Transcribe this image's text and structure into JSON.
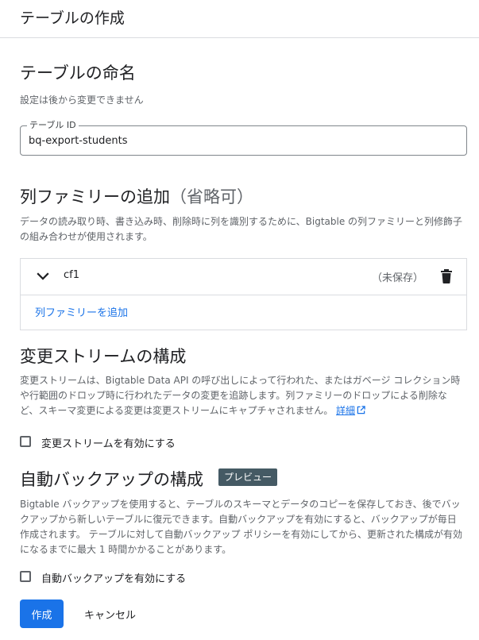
{
  "header": {
    "title": "テーブルの作成"
  },
  "naming": {
    "heading": "テーブルの命名",
    "note": "設定は後から変更できません",
    "table_id_label": "テーブル ID",
    "table_id_value": "bq-export-students"
  },
  "column_families": {
    "heading": "列ファミリーの追加",
    "heading_suffix": "（省略可）",
    "description": "データの読み取り時、書き込み時、削除時に列を識別するために、Bigtable の列ファミリーと列修飾子の組み合わせが使用されます。",
    "items": [
      {
        "name": "cf1",
        "status": "（未保存）",
        "icon_expand": "chevron-down-icon",
        "icon_delete": "trash-icon"
      }
    ],
    "add_label": "列ファミリーを追加"
  },
  "change_streams": {
    "heading": "変更ストリームの構成",
    "description": "変更ストリームは、Bigtable Data API の呼び出しによって行われた、またはガベージ コレクション時や行範囲のドロップ時に行われたデータの変更を追跡します。列ファミリーのドロップによる削除など、スキーマ変更による変更は変更ストリームにキャプチャされません。",
    "learn_more": "詳細",
    "learn_more_icon": "external-link-icon",
    "checkbox_label": "変更ストリームを有効にする",
    "checked": false
  },
  "auto_backup": {
    "heading": "自動バックアップの構成",
    "badge": "プレビュー",
    "description": "Bigtable バックアップを使用すると、テーブルのスキーマとデータのコピーを保存しておき、後でバックアップから新しいテーブルに復元できます。自動バックアップを有効にすると、バックアップが毎日作成されます。 テーブルに対して自動バックアップ ポリシーを有効にしてから、更新された構成が有効になるまでに最大 1 時間かかることがあります。",
    "checkbox_label": "自動バックアップを有効にする",
    "checked": false
  },
  "actions": {
    "create_label": "作成",
    "cancel_label": "キャンセル"
  },
  "colors": {
    "primary": "#1a73e8",
    "text": "#202124",
    "muted": "#5f6368",
    "badge_bg": "#455a64",
    "border": "#dadce0"
  }
}
